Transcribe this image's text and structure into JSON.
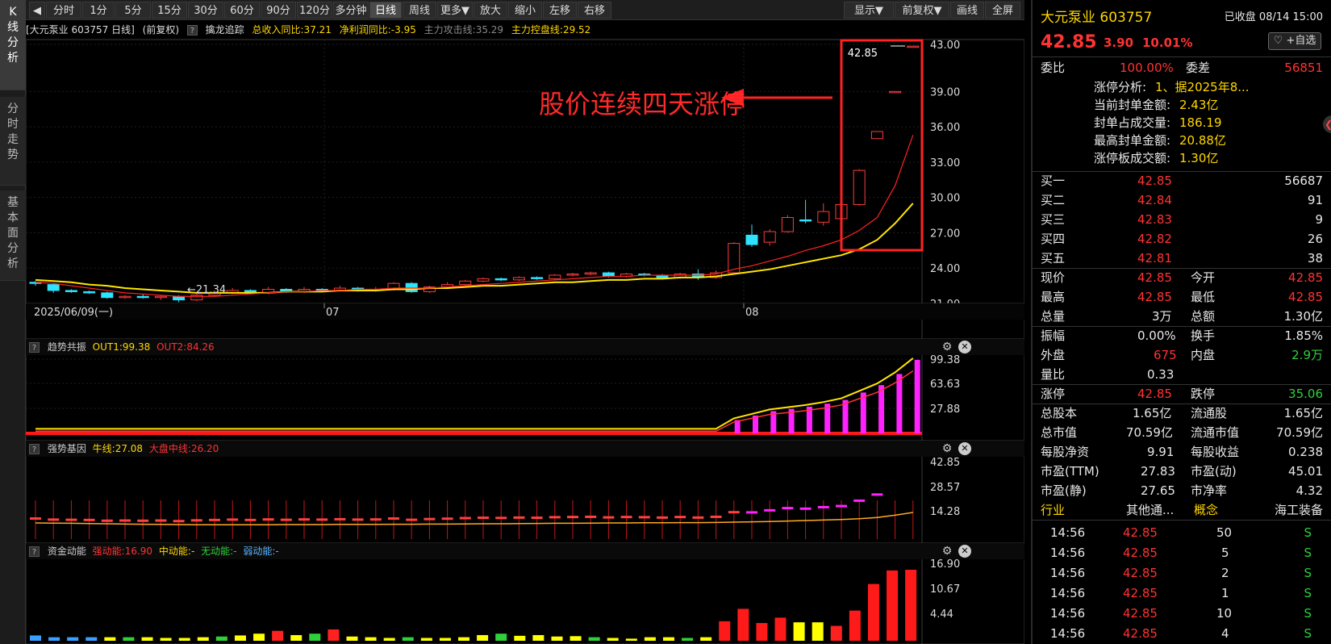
{
  "leftnav": [
    "K线分析",
    "分时走势",
    "基本面分析"
  ],
  "toolbar": {
    "left": [
      "◀",
      "分时",
      "1分",
      "5分",
      "15分",
      "30分",
      "60分",
      "90分",
      "120分",
      "多分钟",
      "日线",
      "周线",
      "更多▼",
      "放大",
      "缩小",
      "左移",
      "右移"
    ],
    "right": [
      "显示▼",
      "前复权▼",
      "画线",
      "全屏"
    ],
    "active": "日线"
  },
  "infobar": {
    "stock": "[大元泵业 603757 日线]",
    "fq": "(前复权)",
    "indicator": "擒龙追踪",
    "rev": "总收入同比:37.21",
    "profit": "净利润同比:-3.95",
    "attack": "主力攻击线:35.29",
    "control": "主力控盘线:29.52"
  },
  "main_chart": {
    "price_last": "42.85",
    "low_label": "21.34",
    "annotation": "股价连续四天涨停",
    "yticks": [
      "43.00",
      "39.00",
      "36.00",
      "33.00",
      "30.00",
      "27.00",
      "24.00",
      "21.00"
    ],
    "xlabels": [
      "2025/06/09(一)",
      "07",
      "08"
    ]
  },
  "panel1": {
    "name": "趋势共振",
    "out1": "OUT1:99.38",
    "out2": "OUT2:84.26",
    "yticks": [
      "99.38",
      "63.63",
      "27.88"
    ]
  },
  "panel2": {
    "name": "强势基因",
    "bull": "牛线:27.08",
    "mid": "大盘中线:26.20",
    "yticks": [
      "42.85",
      "28.57",
      "14.28"
    ]
  },
  "panel3": {
    "name": "资金动能",
    "strong": "强动能:16.90",
    "middle": "中动能:-",
    "none": "无动能:-",
    "weak": "弱动能:-",
    "yticks": [
      "16.90",
      "10.67",
      "4.44"
    ]
  },
  "chart_data": {
    "type": "candlestick",
    "candles": [
      [
        22.8,
        22.7,
        22.9,
        22.5
      ],
      [
        22.6,
        22.1,
        22.7,
        21.9
      ],
      [
        22.1,
        22.0,
        22.2,
        21.9
      ],
      [
        22.0,
        21.9,
        22.1,
        21.8
      ],
      [
        21.9,
        21.5,
        22.0,
        21.4
      ],
      [
        21.5,
        21.6,
        21.7,
        21.4
      ],
      [
        21.6,
        21.5,
        21.8,
        21.4
      ],
      [
        21.5,
        21.6,
        21.7,
        21.3
      ],
      [
        21.6,
        21.3,
        21.7,
        21.1
      ],
      [
        21.3,
        21.7,
        21.8,
        21.2
      ],
      [
        21.7,
        21.9,
        22.1,
        21.6
      ],
      [
        21.9,
        22.1,
        22.3,
        21.8
      ],
      [
        22.1,
        21.9,
        22.2,
        21.8
      ],
      [
        21.9,
        22.2,
        22.4,
        21.8
      ],
      [
        22.2,
        22.0,
        22.3,
        21.9
      ],
      [
        22.0,
        22.2,
        22.4,
        21.9
      ],
      [
        22.2,
        22.1,
        22.3,
        22.0
      ],
      [
        22.1,
        22.3,
        22.5,
        22.0
      ],
      [
        22.3,
        22.1,
        22.4,
        22.0
      ],
      [
        22.1,
        22.2,
        22.4,
        22.0
      ],
      [
        22.2,
        22.7,
        22.8,
        22.1
      ],
      [
        22.7,
        22.0,
        22.8,
        21.9
      ],
      [
        22.0,
        22.4,
        22.5,
        21.9
      ],
      [
        22.4,
        22.6,
        22.8,
        22.3
      ],
      [
        22.6,
        22.9,
        23.0,
        22.5
      ],
      [
        22.9,
        23.1,
        23.2,
        22.8
      ],
      [
        23.1,
        23.0,
        23.2,
        22.9
      ],
      [
        23.0,
        23.2,
        23.3,
        22.9
      ],
      [
        23.2,
        23.1,
        23.3,
        23.0
      ],
      [
        23.1,
        23.4,
        23.5,
        23.0
      ],
      [
        23.4,
        23.5,
        23.6,
        23.3
      ],
      [
        23.5,
        23.6,
        23.7,
        23.4
      ],
      [
        23.6,
        23.3,
        23.7,
        23.2
      ],
      [
        23.3,
        23.5,
        23.6,
        23.2
      ],
      [
        23.5,
        23.4,
        23.6,
        23.3
      ],
      [
        23.4,
        23.2,
        23.5,
        23.1
      ],
      [
        23.2,
        23.5,
        23.6,
        23.1
      ],
      [
        23.5,
        23.2,
        23.9,
        23.0
      ],
      [
        23.2,
        23.6,
        23.8,
        23.1
      ],
      [
        23.6,
        26.1,
        26.2,
        23.5
      ],
      [
        26.8,
        26.0,
        27.7,
        25.8
      ],
      [
        26.2,
        27.1,
        27.3,
        25.9
      ],
      [
        27.1,
        28.3,
        28.5,
        27.0
      ],
      [
        28.1,
        28.0,
        29.8,
        27.8
      ],
      [
        27.9,
        28.8,
        29.5,
        27.6
      ],
      [
        28.2,
        29.4,
        30.5,
        27.2
      ],
      [
        29.4,
        32.3,
        32.4,
        29.3
      ],
      [
        35.0,
        35.6,
        35.6,
        35.0
      ],
      [
        39.0,
        39.0,
        39.0,
        39.0
      ],
      [
        42.85,
        42.85,
        42.85,
        42.85
      ]
    ],
    "ma_red": [
      22.8,
      22.7,
      22.5,
      22.3,
      22.1,
      21.9,
      21.8,
      21.7,
      21.6,
      21.6,
      21.6,
      21.7,
      21.8,
      21.9,
      22.0,
      22.0,
      22.1,
      22.1,
      22.2,
      22.2,
      22.3,
      22.3,
      22.3,
      22.4,
      22.5,
      22.6,
      22.7,
      22.8,
      22.9,
      23.0,
      23.1,
      23.2,
      23.3,
      23.3,
      23.4,
      23.4,
      23.4,
      23.4,
      23.5,
      23.9,
      24.2,
      24.6,
      25.0,
      25.5,
      25.9,
      26.4,
      27.2,
      28.3,
      31.0,
      35.3
    ],
    "ma_yellow": [
      23.0,
      22.9,
      22.8,
      22.6,
      22.5,
      22.3,
      22.2,
      22.1,
      22.0,
      21.9,
      21.9,
      21.9,
      21.9,
      21.9,
      22.0,
      22.0,
      22.0,
      22.1,
      22.1,
      22.1,
      22.2,
      22.2,
      22.3,
      22.3,
      22.4,
      22.5,
      22.5,
      22.6,
      22.7,
      22.8,
      22.8,
      22.9,
      23.0,
      23.0,
      23.1,
      23.1,
      23.2,
      23.2,
      23.3,
      23.5,
      23.7,
      23.9,
      24.2,
      24.5,
      24.8,
      25.1,
      25.6,
      26.4,
      27.8,
      29.5
    ],
    "trend_bars": [
      3,
      3,
      3,
      3,
      3,
      3,
      3,
      3,
      3,
      3,
      3,
      3,
      3,
      3,
      3,
      3,
      3,
      3,
      3,
      3,
      3,
      3,
      3,
      3,
      3,
      3,
      3,
      3,
      3,
      3,
      3,
      3,
      3,
      3,
      3,
      3,
      3,
      3,
      3,
      18,
      24,
      30,
      33,
      36,
      40,
      45,
      55,
      65,
      80,
      99
    ],
    "vol_bars": [
      1.5,
      1.0,
      1.0,
      1.0,
      1.0,
      1.0,
      1.0,
      0.8,
      0.8,
      1.0,
      1.2,
      1.5,
      2.0,
      2.8,
      1.6,
      2.0,
      3.2,
      1.2,
      1.0,
      0.8,
      1.0,
      0.8,
      0.8,
      1.0,
      1.6,
      2.0,
      1.4,
      1.6,
      1.2,
      1.3,
      1.0,
      0.8,
      0.6,
      1.0,
      1.0,
      0.8,
      1.0,
      5.5,
      9.0,
      5.0,
      6.5,
      5.2,
      5.2,
      4.2,
      8.5,
      16.0,
      19.8,
      20.0
    ]
  }
}
